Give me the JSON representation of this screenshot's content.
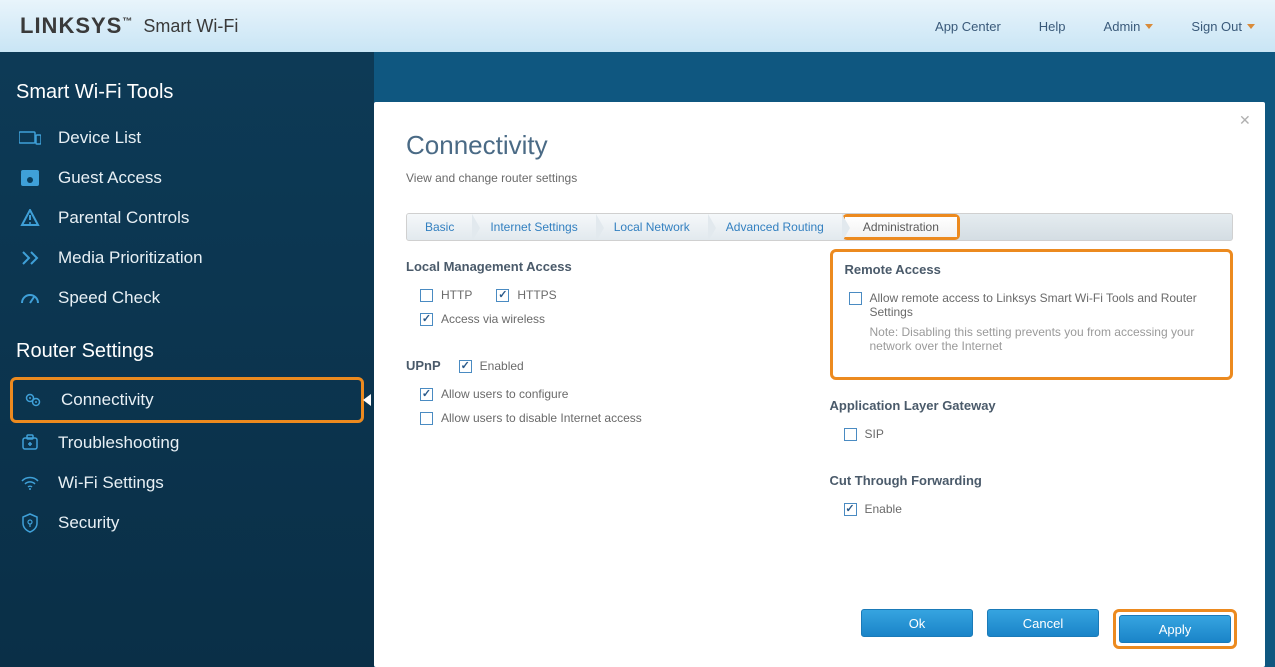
{
  "brand": {
    "logo": "LINKSYS",
    "tm": "™",
    "sub": "Smart Wi-Fi"
  },
  "header": {
    "appCenter": "App Center",
    "help": "Help",
    "admin": "Admin",
    "signOut": "Sign Out"
  },
  "sidebar": {
    "tools": {
      "title": "Smart Wi-Fi Tools",
      "items": [
        {
          "icon": "devices",
          "label": "Device List"
        },
        {
          "icon": "guest",
          "label": "Guest Access"
        },
        {
          "icon": "parental",
          "label": "Parental Controls"
        },
        {
          "icon": "media",
          "label": "Media Prioritization"
        },
        {
          "icon": "speed",
          "label": "Speed Check"
        }
      ]
    },
    "router": {
      "title": "Router Settings",
      "items": [
        {
          "icon": "connectivity",
          "label": "Connectivity"
        },
        {
          "icon": "troubleshoot",
          "label": "Troubleshooting"
        },
        {
          "icon": "wifi",
          "label": "Wi-Fi Settings"
        },
        {
          "icon": "security",
          "label": "Security"
        }
      ]
    }
  },
  "page": {
    "title": "Connectivity",
    "subtitle": "View and change router settings"
  },
  "tabs": {
    "basic": "Basic",
    "internet": "Internet Settings",
    "local": "Local Network",
    "advrouting": "Advanced Routing",
    "admin": "Administration"
  },
  "admin": {
    "localMgmt": {
      "title": "Local Management Access",
      "http": "HTTP",
      "https": "HTTPS",
      "wireless": "Access via wireless"
    },
    "upnp": {
      "title": "UPnP",
      "enabled": "Enabled",
      "configure": "Allow users to configure",
      "disableInternet": "Allow users to disable Internet access"
    },
    "remote": {
      "title": "Remote Access",
      "allow": "Allow remote access to Linksys Smart Wi-Fi Tools and Router Settings",
      "note": "Note: Disabling this setting prevents you from accessing your network over the Internet"
    },
    "alg": {
      "title": "Application Layer Gateway",
      "sip": "SIP"
    },
    "ctf": {
      "title": "Cut Through Forwarding",
      "enable": "Enable"
    }
  },
  "buttons": {
    "ok": "Ok",
    "cancel": "Cancel",
    "apply": "Apply"
  }
}
